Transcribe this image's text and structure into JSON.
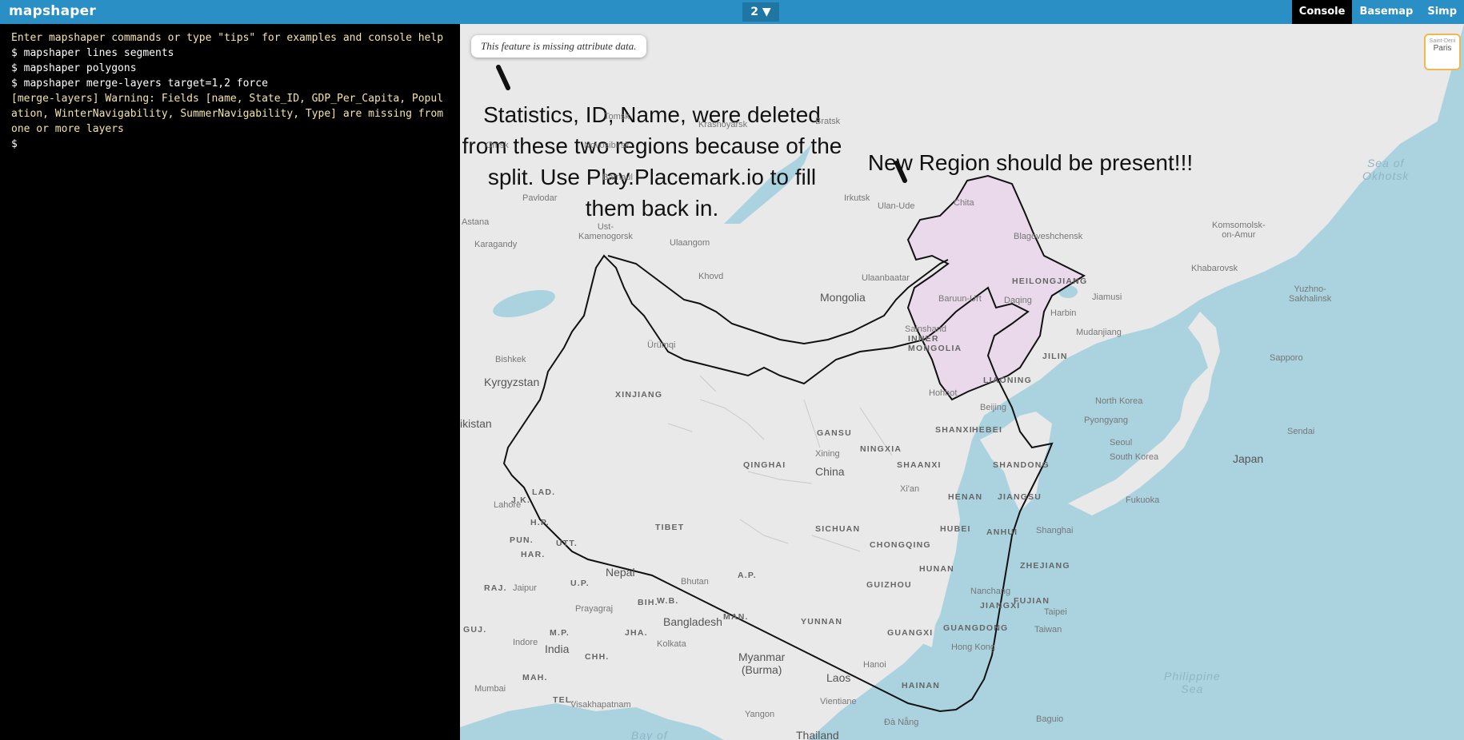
{
  "app": {
    "title": "mapshaper"
  },
  "toolbar": {
    "layer_label": "2 ▼",
    "items": [
      "Console",
      "Basemap",
      "Simp"
    ]
  },
  "console": {
    "lines": [
      {
        "cls": "info",
        "text": "Enter mapshaper commands or type \"tips\" for examples and console help"
      },
      {
        "cls": "",
        "text": "$ mapshaper lines segments"
      },
      {
        "cls": "",
        "text": "$ mapshaper polygons"
      },
      {
        "cls": "",
        "text": "$ mapshaper merge-layers target=1,2 force"
      },
      {
        "cls": "warn",
        "text": "[merge-layers] Warning: Fields [name, State_ID, GDP_Per_Capita, Population, WinterNavigability, SummerNavigability, Type] are missing from one or more layers"
      },
      {
        "cls": "",
        "text": "$"
      }
    ]
  },
  "map": {
    "tooltip": "This feature is missing attribute data.",
    "annotation_left": "Statistics, ID, Name, were deleted from these two regions because of the split. Use Play.Placemark.io to fill them back in.",
    "annotation_right": "New Region should be present!!!",
    "basemap_thumb": {
      "line1": "Saint-Deni",
      "line2": "Paris"
    },
    "labels": {
      "tomsk": "Tomsk",
      "krasnoyarsk": "Krasnoyarsk",
      "bratsk": "Bratsk",
      "omsk": "Omsk",
      "novosibirsk": "Novosibirsk",
      "barnaul": "Barnaul",
      "pavlodar": "Pavlodar",
      "irkutsk": "Irkutsk",
      "ulan_ude": "Ulan-Ude",
      "chita": "Chita",
      "astana": "Astana",
      "karagandy": "Karagandy",
      "ust": "Ust-\nKamenogorsk",
      "ulaangom": "Ulaangom",
      "khovd": "Khovd",
      "ulaanbaatar": "Ulaanbaatar",
      "mongolia": "Mongolia",
      "baruun": "Baruun-Urt",
      "sainshand": "Sainshand",
      "urumqi": "Ürümqi",
      "bishkek": "Bishkek",
      "kyrgyzstan": "Kyrgyzstan",
      "xinjiang": "XINJIANG",
      "ikistan": "ikistan",
      "blago": "Blagoveshchensk",
      "khabarovsk": "Khabarovsk",
      "komsomolsk": "Komsomolsk-\non-Amur",
      "heilongjiang": "HEILONGJIANG",
      "daqing": "Daqing",
      "jiamusi": "Jiamusi",
      "harbin": "Harbin",
      "mudanjiang": "Mudanjiang",
      "jilin": "JILIN",
      "inner_mongolia": "INNER\nMONGOLIA",
      "liaoning": "LIAONING",
      "hohhot": "Hohhot",
      "beijing": "Beijing",
      "north_korea": "North Korea",
      "pyongyang": "Pyongyang",
      "seoul": "Seoul",
      "south_korea": "South Korea",
      "shanxi": "SHANXI",
      "hebei": "HEBEI",
      "gansu": "GANSU",
      "ningxia": "NINGXIA",
      "shaanxi": "SHAANXI",
      "shandong": "SHANDONG",
      "qinghai": "QINGHAI",
      "xining": "Xining",
      "china": "China",
      "xian": "Xi'an",
      "henan": "HENAN",
      "jiangsu": "JIANGSU",
      "tibet": "TIBET",
      "sichuan": "SICHUAN",
      "hubei": "HUBEI",
      "anhui": "ANHUI",
      "shanghai": "Shanghai",
      "chongqing": "CHONGQING",
      "hunan": "HUNAN",
      "zhejiang": "ZHEJIANG",
      "nanchang": "Nanchang",
      "jiangxi": "JIANGXI",
      "guizhou": "GUIZHOU",
      "fujian": "FUJIAN",
      "yunnan": "YUNNAN",
      "guangxi": "GUANGXI",
      "guangdong": "GUANGDONG",
      "taipei": "Taipei",
      "taiwan": "Taiwan",
      "hong_kong": "Hong Kong",
      "hainan": "HAINAN",
      "laos": "Laos",
      "myanmar": "Myanmar\n(Burma)",
      "thailand": "Thailand",
      "hanoi": "Hanoi",
      "vientiane": "Vientiane",
      "yangon": "Yangon",
      "da_nang": "Đà Nẵng",
      "bangladesh": "Bangladesh",
      "bhutan": "Bhutan",
      "nepal": "Nepal",
      "india": "India",
      "kolkata": "Kolkata",
      "mumbai": "Mumbai",
      "visakhapatnam": "Visakhapatnam",
      "prayagraj": "Prayagraj",
      "jaipur": "Jaipur",
      "indore": "Indore",
      "lahore": "Lahore",
      "jk": "J.K.",
      "lad": "LAD.",
      "hp": "H.P.",
      "pun": "PUN.",
      "utt": "UTT.",
      "har": "HAR.",
      "raj": "RAJ.",
      "up": "U.P.",
      "bih": "BIH.",
      "guj": "GUJ.",
      "mp": "M.P.",
      "jha": "JHA.",
      "chh": "CHH.",
      "mah": "MAH.",
      "tel": "TEL.",
      "wb": "W.B.",
      "ap": "A.P.",
      "man": "MAN.",
      "sea_okhotsk": "Sea of\nOkhotsk",
      "yuzhno": "Yuzhno-\nSakhalinsk",
      "sapporo": "Sapporo",
      "sendai": "Sendai",
      "japan": "Japan",
      "fukuoka": "Fukuoka",
      "philippine_sea": "Philippine\nSea",
      "baguio": "Baguio",
      "bay_of": "Bay of"
    }
  }
}
